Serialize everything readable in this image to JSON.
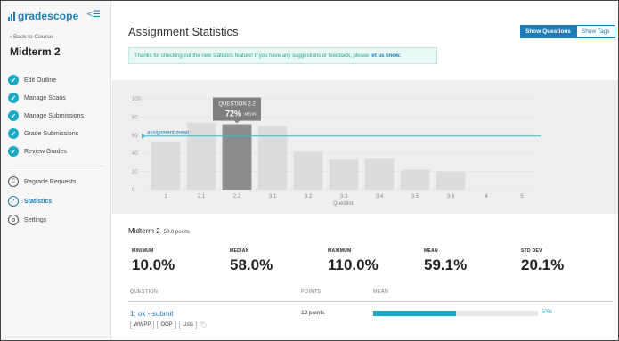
{
  "brand": {
    "logo_text": "gradescope",
    "collapse_icon": "collapse-menu-icon"
  },
  "sidebar": {
    "back_link": "‹ Back to Course",
    "course_title": "Midterm 2",
    "items": [
      {
        "label": "Edit Outline",
        "icon": "check-circle-icon"
      },
      {
        "label": "Manage Scans",
        "icon": "check-circle-icon"
      },
      {
        "label": "Manage Submissions",
        "icon": "check-circle-icon"
      },
      {
        "label": "Grade Submissions",
        "icon": "check-circle-icon"
      },
      {
        "label": "Review Grades",
        "icon": "check-circle-icon"
      },
      {
        "label": "Regrade Requests",
        "icon": "regrade-icon"
      },
      {
        "label": "Statistics",
        "icon": "statistics-icon"
      },
      {
        "label": "Settings",
        "icon": "settings-icon"
      }
    ]
  },
  "header": {
    "title": "Assignment Statistics",
    "show_questions": "Show Questions",
    "show_tags": "Show Tags"
  },
  "notice": {
    "text": "Thanks for checking out the new statistics feature! If you have any suggestions or feedback, please ",
    "link": "let us know."
  },
  "chart_data": {
    "type": "bar",
    "categories": [
      "1",
      "2.1",
      "2.2",
      "3.1",
      "3.2",
      "3.3",
      "3.4",
      "3.5",
      "3.6",
      "4",
      "5"
    ],
    "values": [
      52,
      74,
      72,
      70,
      42,
      33,
      34,
      22,
      20,
      0,
      0
    ],
    "highlighted_index": 2,
    "xlabel": "Question",
    "ylabel": "",
    "ylim": [
      0,
      100
    ],
    "yticks": [
      0,
      20,
      40,
      60,
      80,
      100
    ],
    "reference_line": {
      "label": "assignment mean",
      "value": 59.1
    },
    "tooltip": {
      "title": "QUESTION 2.2",
      "value": "72%",
      "unit": "MEAN"
    },
    "colors": {
      "bar": "#dcdcdc",
      "highlight": "#8c8c8c",
      "mean_line": "#3fb8c9"
    }
  },
  "summary": {
    "title": "Midterm 2",
    "points": "50.0 points",
    "stats": [
      {
        "label": "MINIMUM",
        "value": "10.0%"
      },
      {
        "label": "MEDIAN",
        "value": "58.0%"
      },
      {
        "label": "MAXIMUM",
        "value": "110.0%"
      },
      {
        "label": "MEAN",
        "value": "59.1%"
      },
      {
        "label": "STD DEV",
        "value": "20.1%"
      }
    ]
  },
  "table": {
    "headers": [
      "QUESTION",
      "POINTS",
      "MEAN"
    ],
    "rows": [
      {
        "title": "1: ok --submit",
        "points": "12 points",
        "mean": 0.5,
        "mean_label": "50%",
        "tags": [
          "WWPP",
          "OOP",
          "Lists"
        ]
      }
    ]
  }
}
